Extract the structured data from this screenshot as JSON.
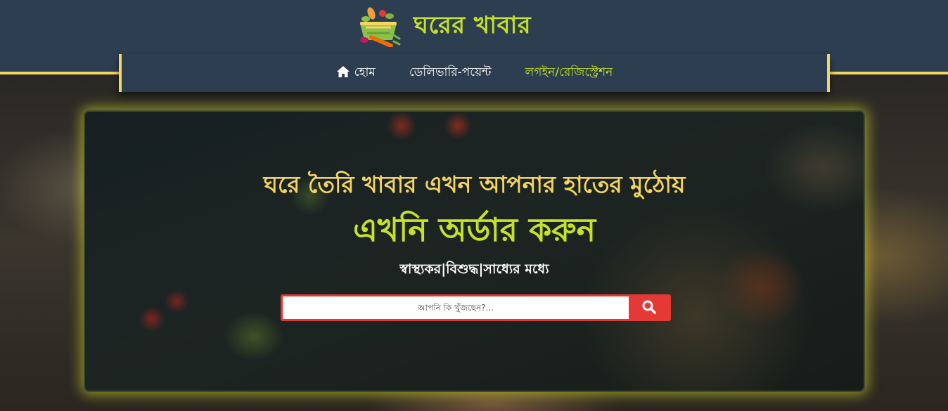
{
  "brand": {
    "name": "ঘরের খাবার",
    "logo_icon": "vegetable-basket-icon"
  },
  "nav": {
    "items": [
      {
        "label": "হোম",
        "icon": "home-icon"
      },
      {
        "label": "ডেলিভারি-পয়েন্ট"
      },
      {
        "label": "লগইন/রেজিস্ট্রেশন",
        "active": true
      }
    ]
  },
  "hero": {
    "headline": "ঘরে তৈরি খাবার এখন আপনার হাতের মুঠোয়",
    "cta": "এখনি অর্ডার করুন",
    "tagline": "স্বাস্থ্যকর|বিশুদ্ধ|সাধ্যের মধ্যে"
  },
  "search": {
    "placeholder": "আপনি কি খুঁজছেন?...",
    "value": "",
    "button_icon": "search-icon"
  },
  "colors": {
    "header_bg": "#2c3e50",
    "accent_yellow": "#f4d560",
    "accent_green": "#c6e227",
    "search_red": "#e53935"
  }
}
